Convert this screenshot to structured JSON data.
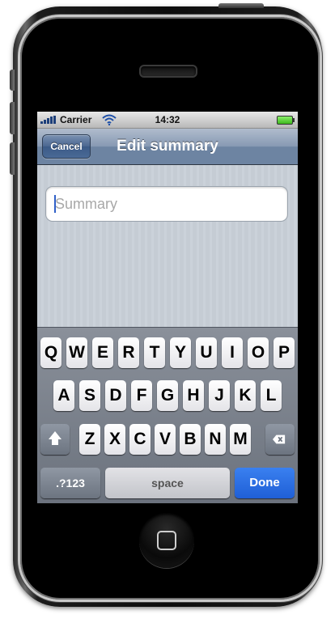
{
  "status_bar": {
    "carrier": "Carrier",
    "time": "14:32",
    "signal_icon": "signal-bars-icon",
    "wifi_icon": "wifi-icon",
    "battery_icon": "battery-icon"
  },
  "nav_bar": {
    "cancel_label": "Cancel",
    "title": "Edit summary"
  },
  "form": {
    "summary": {
      "value": "",
      "placeholder": "Summary"
    }
  },
  "keyboard": {
    "row1": [
      "Q",
      "W",
      "E",
      "R",
      "T",
      "Y",
      "U",
      "I",
      "O",
      "P"
    ],
    "row2": [
      "A",
      "S",
      "D",
      "F",
      "G",
      "H",
      "J",
      "K",
      "L"
    ],
    "row3": [
      "Z",
      "X",
      "C",
      "V",
      "B",
      "N",
      "M"
    ],
    "shift_icon": "shift-arrow-icon",
    "delete_icon": "backspace-icon",
    "numbers_label": ".?123",
    "space_label": "space",
    "done_label": "Done"
  },
  "colors": {
    "nav_bar": "#6d84a2",
    "done_key": "#1f5fd6",
    "background": "#c5ccd4"
  }
}
